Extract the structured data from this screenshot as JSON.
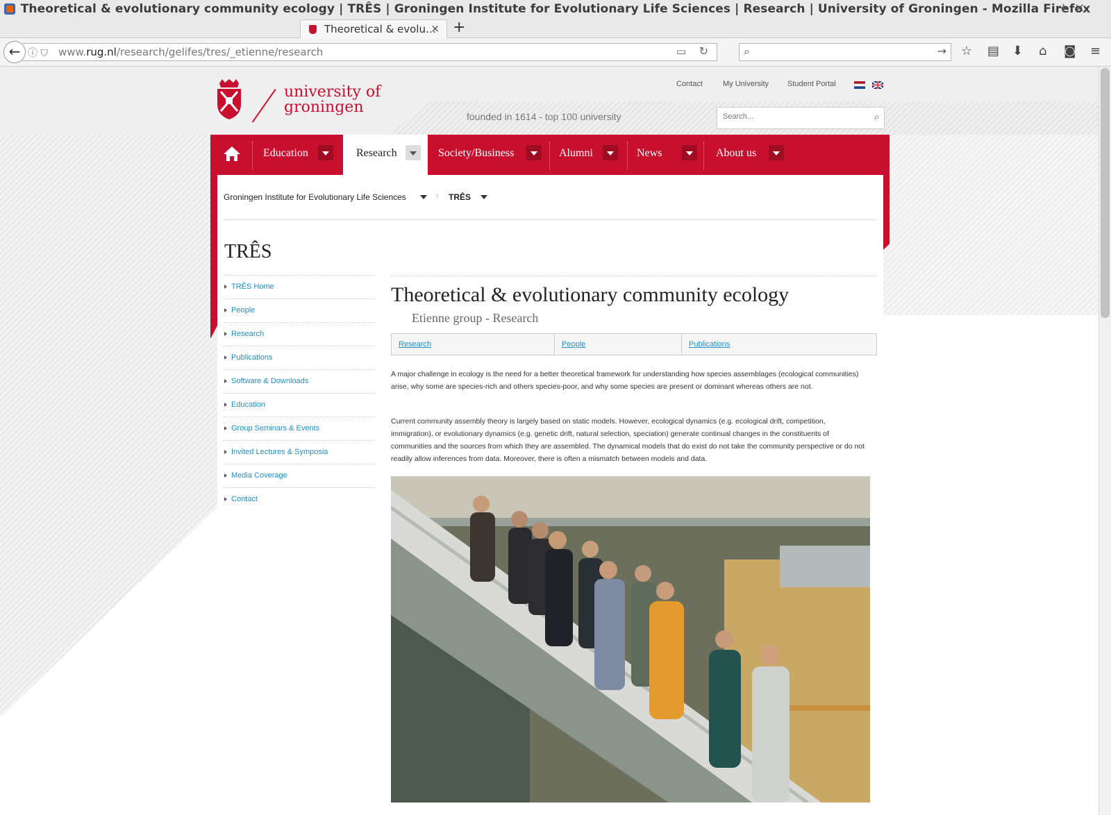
{
  "window": {
    "title": "Theoretical & evolutionary community ecology | TRÊS | Groningen Institute for Evolutionary Life Sciences | Research | University of Groningen - Mozilla Firefox",
    "controls": [
      "–",
      "+",
      "×"
    ]
  },
  "tab": {
    "label": "Theoretical & evolu…",
    "close": "×",
    "new_tab": "+"
  },
  "navbar": {
    "back": "←",
    "info": "ⓘ ⛉",
    "url_prefix": "www.",
    "url_domain": "rug.nl",
    "url_path": "/research/gelifes/tres/_etienne/research",
    "reader": "▭",
    "reload": "↻",
    "search_placeholder": "",
    "search_go": "→",
    "toolbar_icons": [
      "bookmark-star-icon",
      "library-icon",
      "download-icon",
      "home-icon",
      "pocket-icon",
      "menu-icon"
    ]
  },
  "site": {
    "logo_line1": "university of",
    "logo_line2": "groningen",
    "top_links": [
      "Contact",
      "My University",
      "Student Portal"
    ],
    "tagline": "founded in 1614  -  top 100 university",
    "search_placeholder": "Search...",
    "brand_color": "#c8102e"
  },
  "mainnav": {
    "items": [
      {
        "label": "Education"
      },
      {
        "label": "Research",
        "active": true
      },
      {
        "label": "Society/Business"
      },
      {
        "label": "Alumni"
      },
      {
        "label": "News"
      },
      {
        "label": "About us"
      }
    ]
  },
  "breadcrumb": {
    "item1": "Groningen Institute for Evolutionary Life Sciences",
    "separator": "›",
    "item2": "TRÊS"
  },
  "section_title": "TRÊS",
  "sidenav": [
    "TRÊS Home",
    "People",
    "Research",
    "Publications",
    "Software & Downloads",
    "Education",
    "Group Seminars & Events",
    "Invited Lectures & Symposia",
    "Media Coverage",
    "Contact"
  ],
  "article": {
    "title": "Theoretical & evolutionary community ecology",
    "subtitle": "Etienne group - Research",
    "tabs": [
      "Research",
      "People",
      "Publications"
    ],
    "para1": "A major challenge in ecology is the need for a better theoretical framework for understanding how species assemblages (ecological communities) arise, why some are species-rich and others species-poor, and why some species are present or dominant whereas others are not.",
    "para2": "Current community assembly theory is largely based on static models. However, ecological dynamics (e.g. ecological drift, competition, immigration), or evolutionary dynamics (e.g. genetic drift, natural selection, speciation) generate continual changes in the constituents of communities and the sources from which they are assembled. The dynamical models that do exist do not take the community perspective or do not readily allow inferences from data. Moreover, there is often a mismatch between models and data."
  }
}
